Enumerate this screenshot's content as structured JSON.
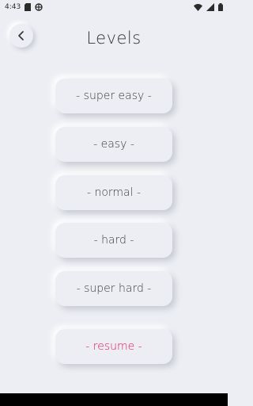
{
  "status_bar": {
    "time": "4:43",
    "left_icons": [
      "sd-card-icon",
      "vpn-icon"
    ],
    "right_icons": [
      "wifi-icon",
      "signal-icon",
      "battery-icon"
    ]
  },
  "header": {
    "title": "Levels",
    "back_icon": "chevron-left-icon"
  },
  "levels": [
    {
      "label": "- super easy -"
    },
    {
      "label": "- easy -"
    },
    {
      "label": "- normal -"
    },
    {
      "label": "- hard -"
    },
    {
      "label": "- super hard -"
    }
  ],
  "resume": {
    "label": "- resume -"
  },
  "colors": {
    "background": "#eceef3",
    "text": "#3d3d3d",
    "accent": "#e0195e",
    "nav_bar": "#000000"
  }
}
